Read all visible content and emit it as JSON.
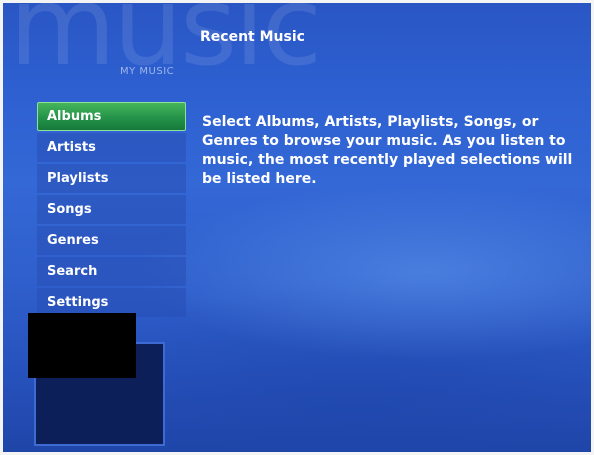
{
  "watermark": "music",
  "section_title": "MY MUSIC",
  "page_title": "Recent Music",
  "menu": {
    "items": [
      {
        "label": "Albums",
        "active": true
      },
      {
        "label": "Artists",
        "active": false
      },
      {
        "label": "Playlists",
        "active": false
      },
      {
        "label": "Songs",
        "active": false
      },
      {
        "label": "Genres",
        "active": false
      },
      {
        "label": "Search",
        "active": false
      },
      {
        "label": "Settings",
        "active": false
      }
    ]
  },
  "description": "Select Albums, Artists, Playlists, Songs, or Genres to browse your music. As you listen to music, the most recently played selections will be listed here.",
  "colors": {
    "background": "#2d5fd0",
    "active_item": "#24934a",
    "text": "#ffffff"
  }
}
